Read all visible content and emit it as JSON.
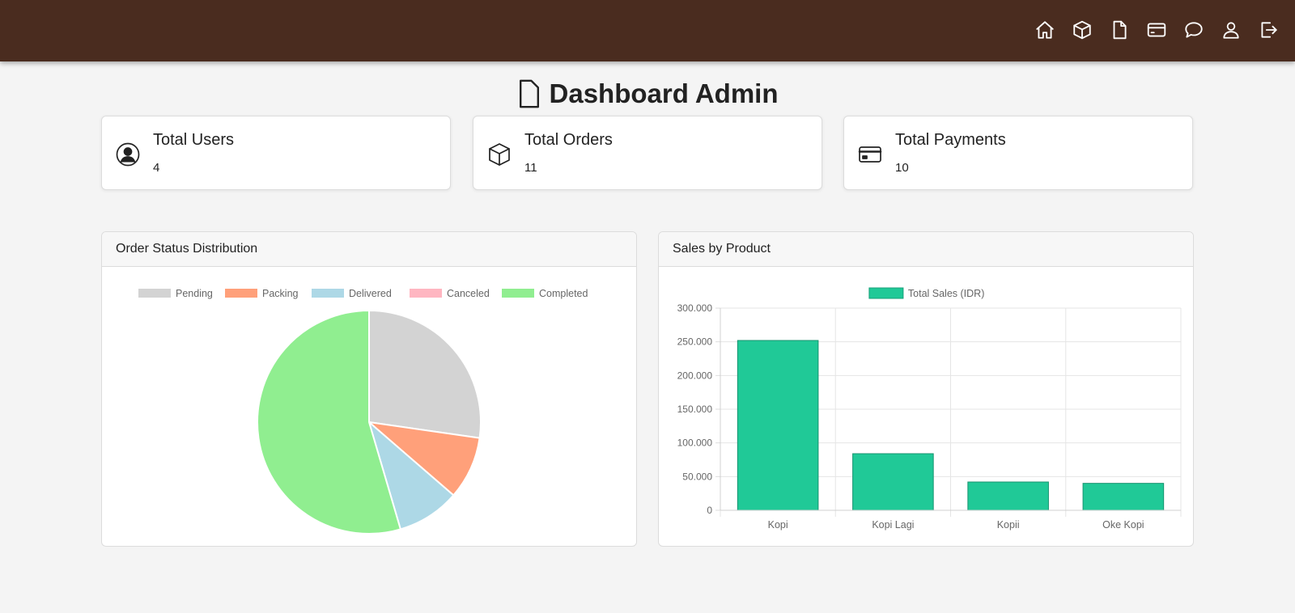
{
  "nav": {
    "icons": [
      "home-icon",
      "box-icon",
      "document-icon",
      "credit-card-icon",
      "chat-icon",
      "user-icon",
      "logout-icon"
    ]
  },
  "header": {
    "title": "Dashboard Admin"
  },
  "stats": {
    "users": {
      "title": "Total Users",
      "value": "4"
    },
    "orders": {
      "title": "Total Orders",
      "value": "11"
    },
    "payments": {
      "title": "Total Payments",
      "value": "10"
    }
  },
  "colors": {
    "topbar": "#4a2c1f",
    "bar": "#20c997"
  },
  "order_panel": {
    "title": "Order Status Distribution"
  },
  "sales_panel": {
    "title": "Sales by Product"
  },
  "chart_data": [
    {
      "type": "pie",
      "categories": [
        "Pending",
        "Packing",
        "Delivered",
        "Canceled",
        "Completed"
      ],
      "values": [
        3,
        1,
        1,
        0,
        6
      ],
      "colors": [
        "#d3d3d3",
        "#ffa07a",
        "#add8e6",
        "#ffb6c1",
        "#90ee90"
      ],
      "legend": "top"
    },
    {
      "type": "bar",
      "categories": [
        "Kopi",
        "Kopi Lagi",
        "Kopii",
        "Oke Kopi"
      ],
      "series": [
        {
          "name": "Total Sales (IDR)",
          "values": [
            252000,
            84000,
            42000,
            40000
          ]
        }
      ],
      "ylim": [
        0,
        300000
      ],
      "yticks": [
        "0",
        "50.000",
        "100.000",
        "150.000",
        "200.000",
        "250.000",
        "300.000"
      ],
      "grid": true,
      "legend": "top"
    }
  ]
}
